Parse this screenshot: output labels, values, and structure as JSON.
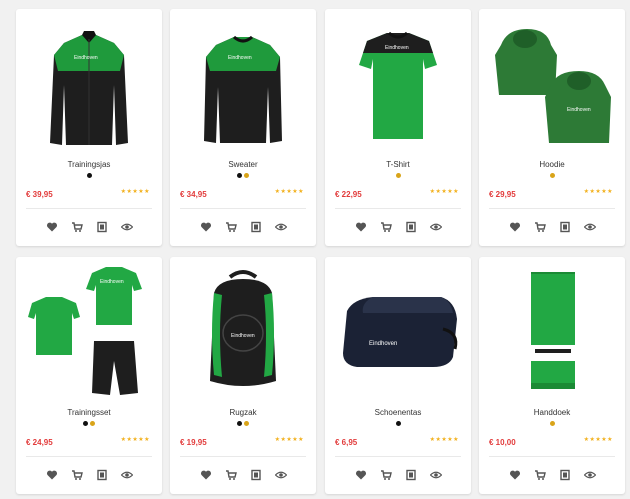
{
  "colors": {
    "price": "#e23b3b",
    "star": "#f2b11d",
    "action_icon": "#555555",
    "green": "#1f9a3c",
    "black": "#1e1e1e"
  },
  "icons": [
    "heart-icon",
    "cart-icon",
    "compare-icon",
    "eye-icon"
  ],
  "products": [
    {
      "name": "Trainingsjas",
      "price": "€ 39,95",
      "stars": "★★★★★",
      "colors": [
        "#111111"
      ],
      "image": "track-jacket"
    },
    {
      "name": "Sweater",
      "price": "€ 34,95",
      "stars": "★★★★★",
      "colors": [
        "#111111",
        "#d9a419"
      ],
      "image": "sweater"
    },
    {
      "name": "T-Shirt",
      "price": "€ 22,95",
      "stars": "★★★★★",
      "colors": [
        "#d9a419"
      ],
      "image": "tshirt"
    },
    {
      "name": "Hoodie",
      "price": "€ 29,95",
      "stars": "★★★★★",
      "colors": [
        "#d9a419"
      ],
      "image": "hoodies"
    },
    {
      "name": "Trainingsset",
      "price": "€ 24,95",
      "stars": "★★★★★",
      "colors": [
        "#111111",
        "#d9a419"
      ],
      "image": "training-set"
    },
    {
      "name": "Rugzak",
      "price": "€ 19,95",
      "stars": "★★★★★",
      "colors": [
        "#111111",
        "#d9a419"
      ],
      "image": "backpack"
    },
    {
      "name": "Schoenentas",
      "price": "€ 6,95",
      "stars": "★★★★★",
      "colors": [
        "#111111"
      ],
      "image": "shoe-bag"
    },
    {
      "name": "Handdoek",
      "price": "€ 10,00",
      "stars": "★★★★★",
      "colors": [
        "#d9a419"
      ],
      "image": "towel"
    }
  ]
}
